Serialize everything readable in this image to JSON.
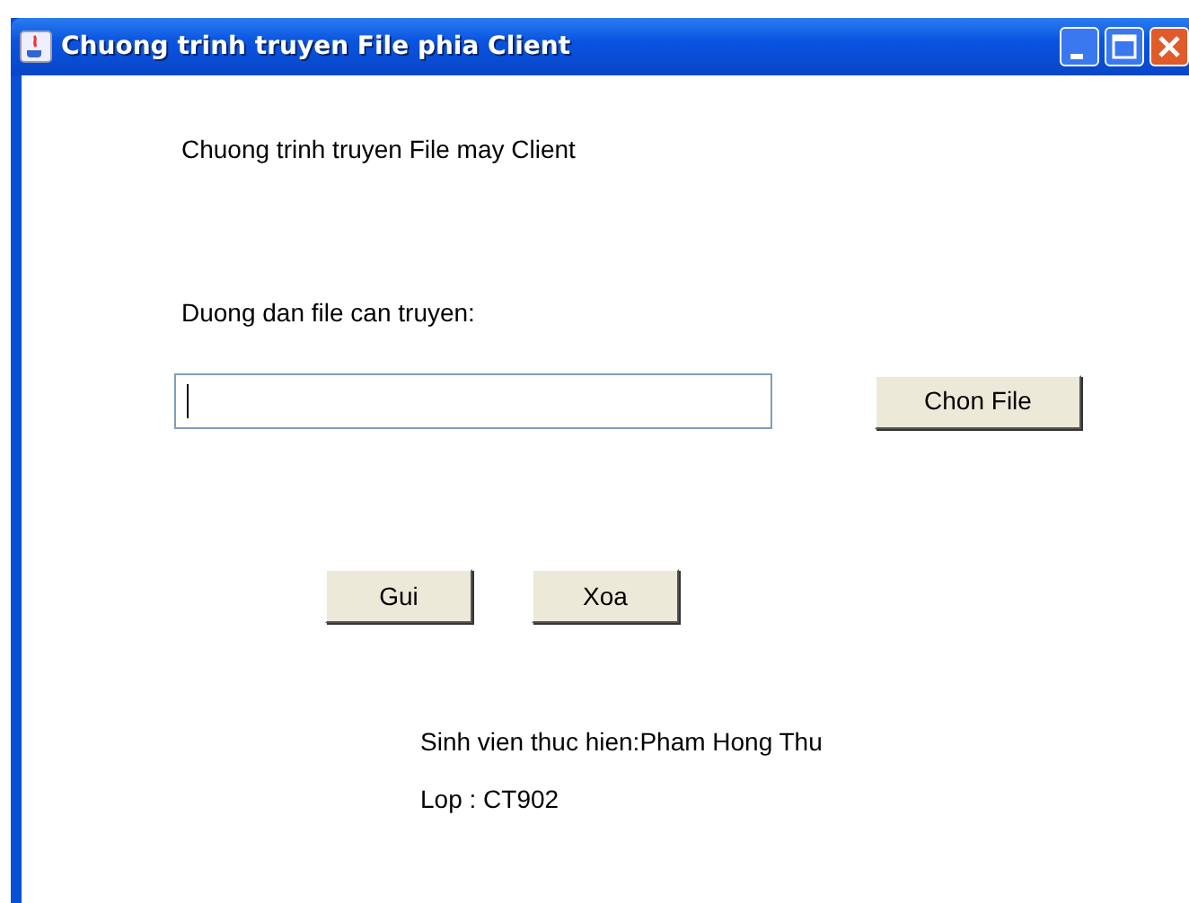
{
  "window": {
    "title": "Chuong trinh truyen File phia Client"
  },
  "heading": "Chuong trinh truyen File may Client",
  "path_label": "Duong dan file can truyen:",
  "path_field": {
    "focused": true
  },
  "browse_button": "Chon File",
  "buttons": [
    "Gui",
    "Xoa"
  ],
  "footer": [
    "Sinh vien thuc hien:Pham Hong Thu",
    "Lop : CT902"
  ]
}
